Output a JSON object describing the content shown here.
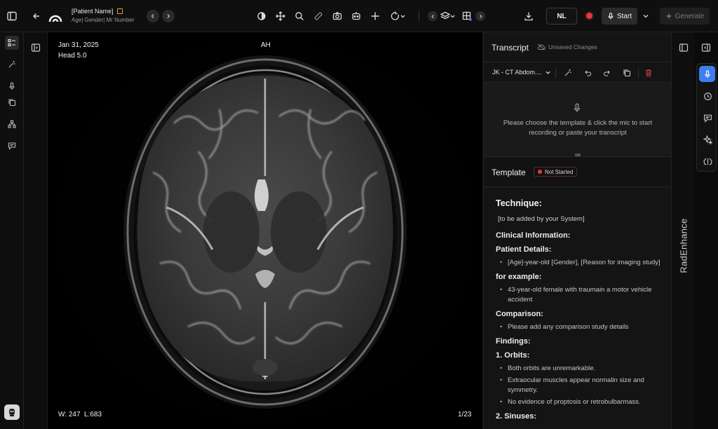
{
  "header": {
    "patient_name": "[Patient Name]",
    "patient_meta": "Age| Gender| Mr Number",
    "language_button": "NL",
    "start_button": "Start",
    "generate_button": "Generate"
  },
  "viewer": {
    "study_date": "Jan 31, 2025",
    "series_label": "Head 5.0",
    "orientation": "AH",
    "window_level": "W: 247  L:683",
    "image_counter": "1/23"
  },
  "transcript": {
    "title": "Transcript",
    "save_status": "Unsaved Changes",
    "template_selector": "JK - CT Abdom....",
    "mic_message": "Please choose the template & click the mic to start recording or paste your transcript"
  },
  "template": {
    "title": "Template",
    "status": "Not Started",
    "technique_heading": "Technique:",
    "technique_text": "[to be added by your System]",
    "clinical_heading": "Clinical Information:",
    "patient_details_heading": "Patient Details:",
    "patient_details_items": [
      "[Age]-year-old [Gender], [Reason for imaging study]"
    ],
    "example_heading": "for example:",
    "example_items": [
      "43-year-old female with traumain a motor vehicle accident"
    ],
    "comparison_heading": "Comparison:",
    "comparison_items": [
      "Please add any comparison study details"
    ],
    "findings_heading": "Findings:",
    "orbits_heading": "1. Orbits:",
    "orbits_items": [
      "Both orbits are unremarkable.",
      "Extraocular muscles appear normalin size and symmetry.",
      "No evidence of proptosis or retrobulbarmass."
    ],
    "sinuses_heading": "2. Sinuses:"
  },
  "sidebar_brand": "RadEnhance",
  "colors": {
    "accent_blue": "#3d7ef2",
    "record_red": "#e23b3b",
    "badge_orange": "#e2a33b"
  }
}
